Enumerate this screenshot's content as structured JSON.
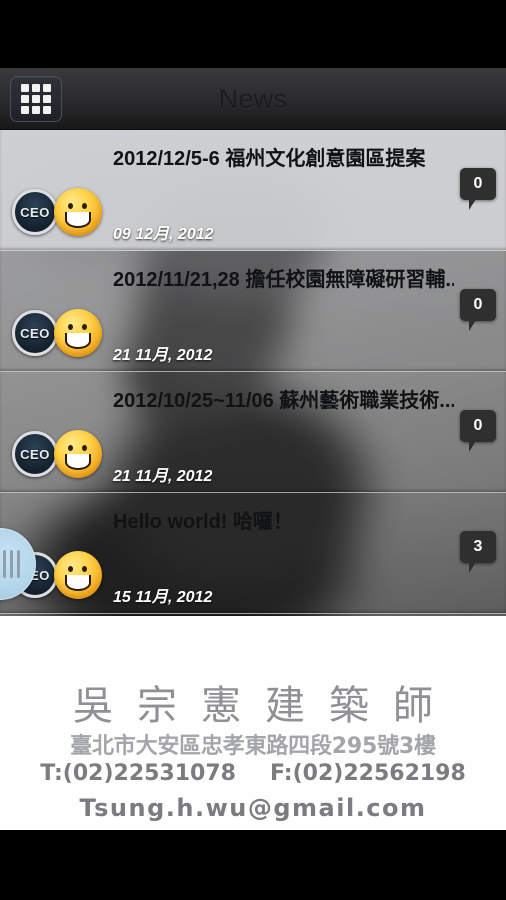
{
  "app": {
    "status_bar": "",
    "header": {
      "title": "News",
      "menu_icon": "grid-apps-icon"
    }
  },
  "news_list": [
    {
      "title": "2012/12/5-6 福州文化創意園區提案",
      "date": "09 12月, 2012",
      "comment_count": "0",
      "avatar_label": "CEO",
      "mood_icon": "smiley-face-icon",
      "selected": true
    },
    {
      "title": "2012/11/21,28 擔任校園無障礙研習輔...",
      "date": "21 11月, 2012",
      "comment_count": "0",
      "avatar_label": "CEO",
      "mood_icon": "smiley-face-icon",
      "selected": false
    },
    {
      "title": "2012/10/25~11/06 蘇州藝術職業技術...",
      "date": "21 11月, 2012",
      "comment_count": "0",
      "avatar_label": "CEO",
      "mood_icon": "smiley-face-icon",
      "selected": false
    },
    {
      "title": "Hello world! 哈囉！",
      "date": "15 11月, 2012",
      "comment_count": "3",
      "avatar_label": "CEO",
      "mood_icon": "smiley-face-icon",
      "selected": false
    }
  ],
  "drag_handle": {
    "icon": "drag-grip-icon"
  },
  "footer_card": {
    "name": "吳宗憲建築師",
    "address": "臺北市大安區忠孝東路四段295號3樓",
    "tel": "T:(02)22531078",
    "fax": "F:(02)22562198",
    "email": "Tsung.h.wu@gmail.com"
  },
  "colors": {
    "header_bg": "#2b2b2d",
    "selected_row": "#d0d1d4",
    "badge_bg": "#2f2f2f",
    "smiley": "#ffd24a",
    "handle": "#b2d4ea",
    "footer_text": "#8f9093"
  }
}
